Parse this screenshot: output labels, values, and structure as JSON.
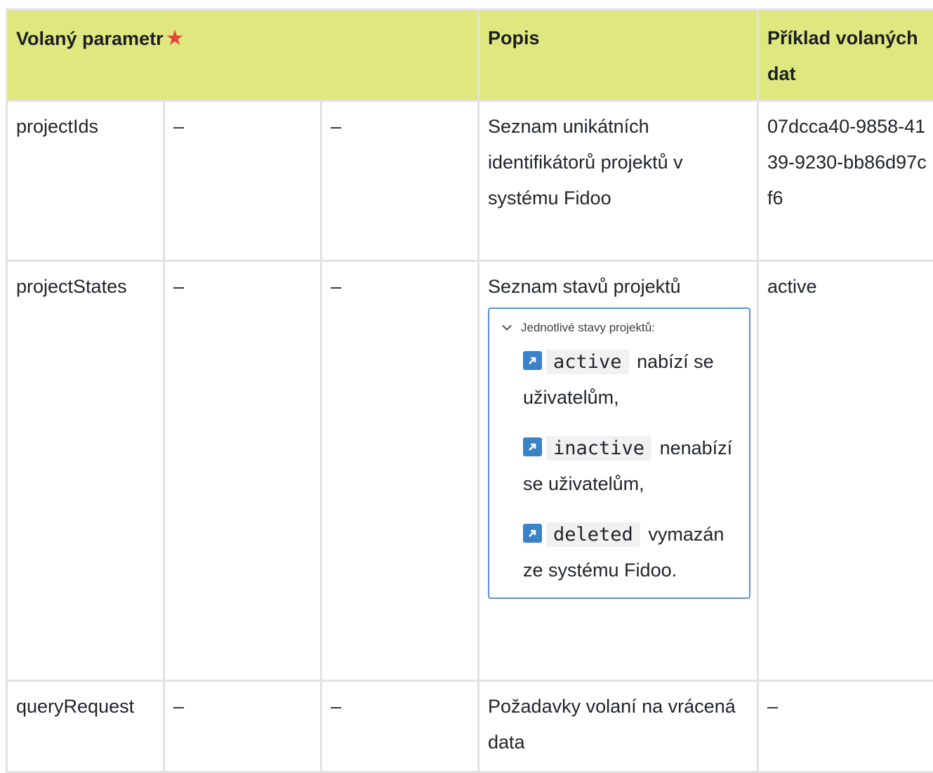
{
  "header": {
    "param": "Volaný parametr",
    "required_icon": "star-icon",
    "required_color": "#e8453c",
    "header_bg": "#dfe87f",
    "description": "Popis",
    "example": "Příklad volaných dat"
  },
  "rows": [
    {
      "name": "projectIds",
      "col2": "–",
      "col3": "–",
      "description": "Seznam unikátních identifikátorů projektů v systému Fidoo",
      "example": "07dcca40-9858-4139-9230-bb86d97cf6"
    },
    {
      "name": "projectStates",
      "col2": "–",
      "col3": "–",
      "description": "Seznam stavů projektů",
      "example": "active",
      "expander": {
        "title": "Jednotlivé stavy projektů:",
        "items": [
          {
            "icon": "link-arrow-icon",
            "code": "active",
            "text": "nabízí se uživatelům,"
          },
          {
            "icon": "link-arrow-icon",
            "code": "inactive",
            "text": "nenabízí se uživatelům,"
          },
          {
            "icon": "link-arrow-icon",
            "code": "deleted",
            "text": "vymazán ze systému Fidoo."
          }
        ]
      }
    },
    {
      "name": "queryRequest",
      "col2": "–",
      "col3": "–",
      "description": "Požadavky volaní na vrácená data",
      "example": "–"
    }
  ]
}
